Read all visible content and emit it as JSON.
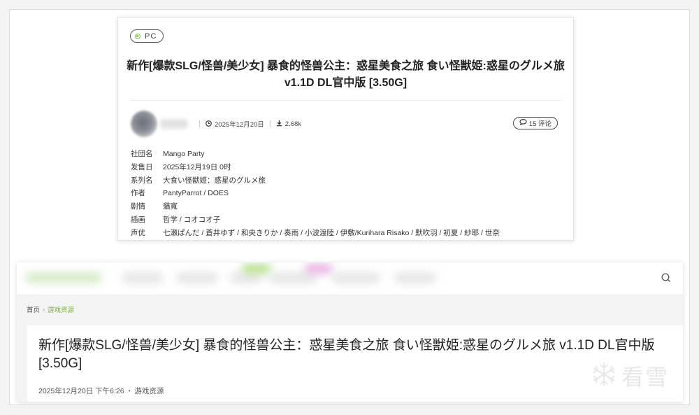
{
  "top_card": {
    "platform_badge": "PC",
    "title": "新作[爆款SLG/怪兽/美少女] 暴食的怪兽公主：惑星美食之旅 食い怪獣姫:惑星のグルメ旅 v1.1D DL官中版 [3.50G]",
    "post_date": "2025年12月20日",
    "downloads": "2.68k",
    "comments": "15 评论",
    "info": [
      {
        "key": "社団名",
        "value": "Mango Party"
      },
      {
        "key": "发售日",
        "value": "2025年12月19日 0时"
      },
      {
        "key": "系列名",
        "value": "大食い怪獣姫：惑星のグルメ旅"
      },
      {
        "key": "作者",
        "value": "PantyParrot / DOES"
      },
      {
        "key": "剧情",
        "value": "貓寬"
      },
      {
        "key": "插画",
        "value": "哲学 / コオコオ子"
      },
      {
        "key": "声优",
        "value": "七瀬ぱんだ / 蒼井ゆず / 和央きりか / 奏雨 / 小波渡陸 / 伊敷/Kurihara Risako / 默吹羽 / 初夏 / 紗耶 / 世奈"
      }
    ],
    "icons": {
      "date": "clock-icon",
      "downloads": "download-icon",
      "comments": "comment-icon"
    }
  },
  "bottom_card": {
    "breadcrumb": {
      "home": "首页",
      "separator": "›",
      "current": "游戏资源"
    },
    "title": "新作[爆款SLG/怪兽/美少女] 暴食的怪兽公主：惑星美食之旅 食い怪獣姫:惑星のグルメ旅 v1.1D DL官中版 [3.50G]",
    "date": "2025年12月20日 下午6:26",
    "meta_dot": "•",
    "category": "游戏资源",
    "search_icon": "search-icon"
  },
  "watermark": {
    "text": "看雪"
  },
  "colors": {
    "accent_green": "#7cb342",
    "badge_green": "#7cc243"
  }
}
